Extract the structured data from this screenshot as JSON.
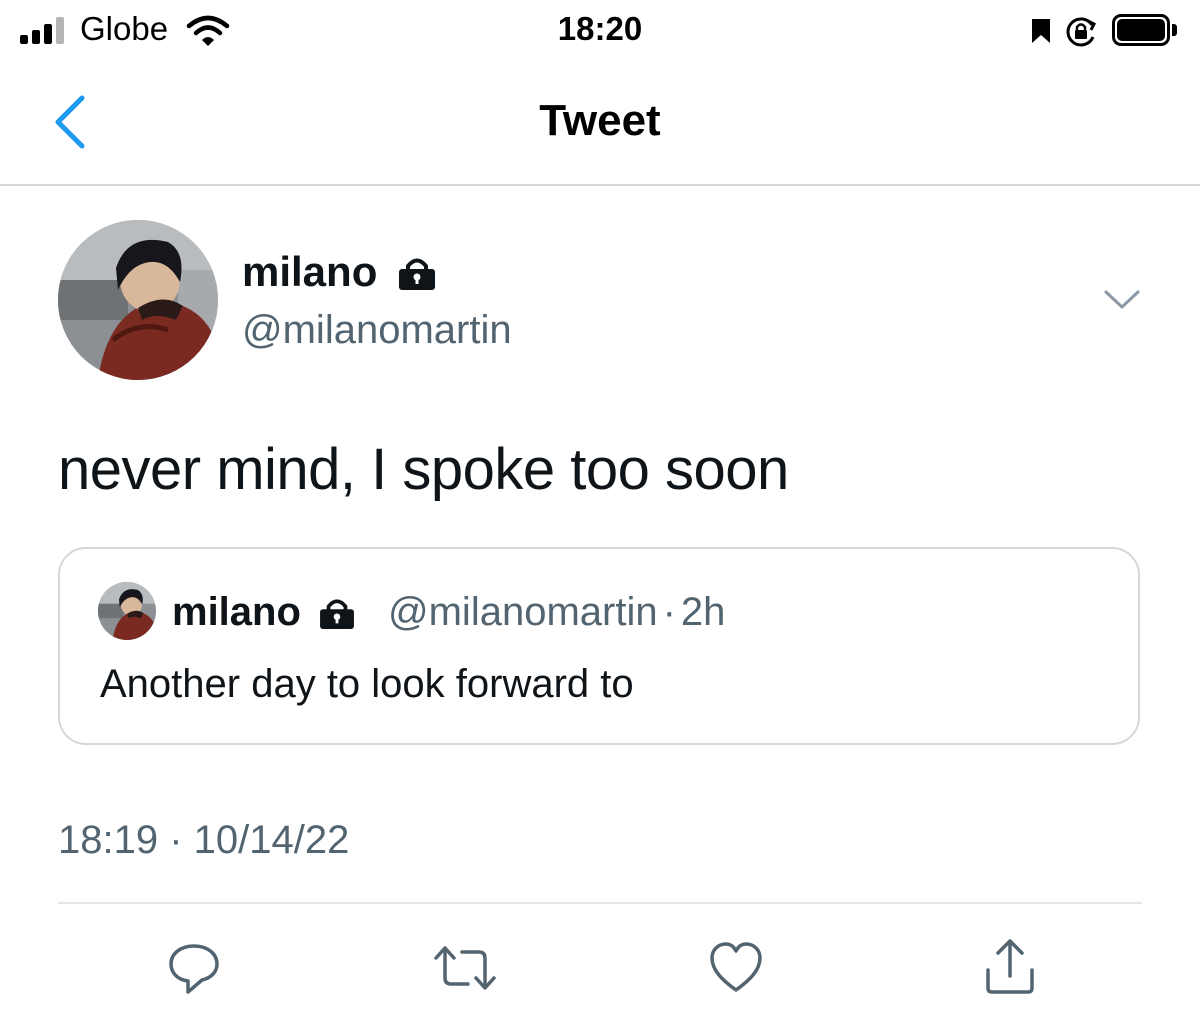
{
  "status_bar": {
    "carrier": "Globe",
    "time": "18:20",
    "icons": [
      "signal-icon",
      "wifi-icon",
      "bookmark-icon",
      "orientation-lock-icon",
      "battery-icon"
    ]
  },
  "nav": {
    "title": "Tweet",
    "back_icon": "chevron-left-icon"
  },
  "tweet": {
    "author_name": "milano",
    "author_handle": "@milanomartin",
    "protected_icon": "lock-icon",
    "more_icon": "chevron-down-icon",
    "text": "never mind, I spoke too soon",
    "timestamp": "18:19 · 10/14/22"
  },
  "quoted_tweet": {
    "author_name": "milano",
    "author_handle": "@milanomartin",
    "age": "2h",
    "separator": "·",
    "text": "Another day to look forward to"
  },
  "actions": [
    "reply-icon",
    "retweet-icon",
    "like-icon",
    "share-icon"
  ],
  "colors": {
    "accent": "#1d9bf0",
    "secondary_text": "#536471",
    "divider": "#d4d7db"
  }
}
